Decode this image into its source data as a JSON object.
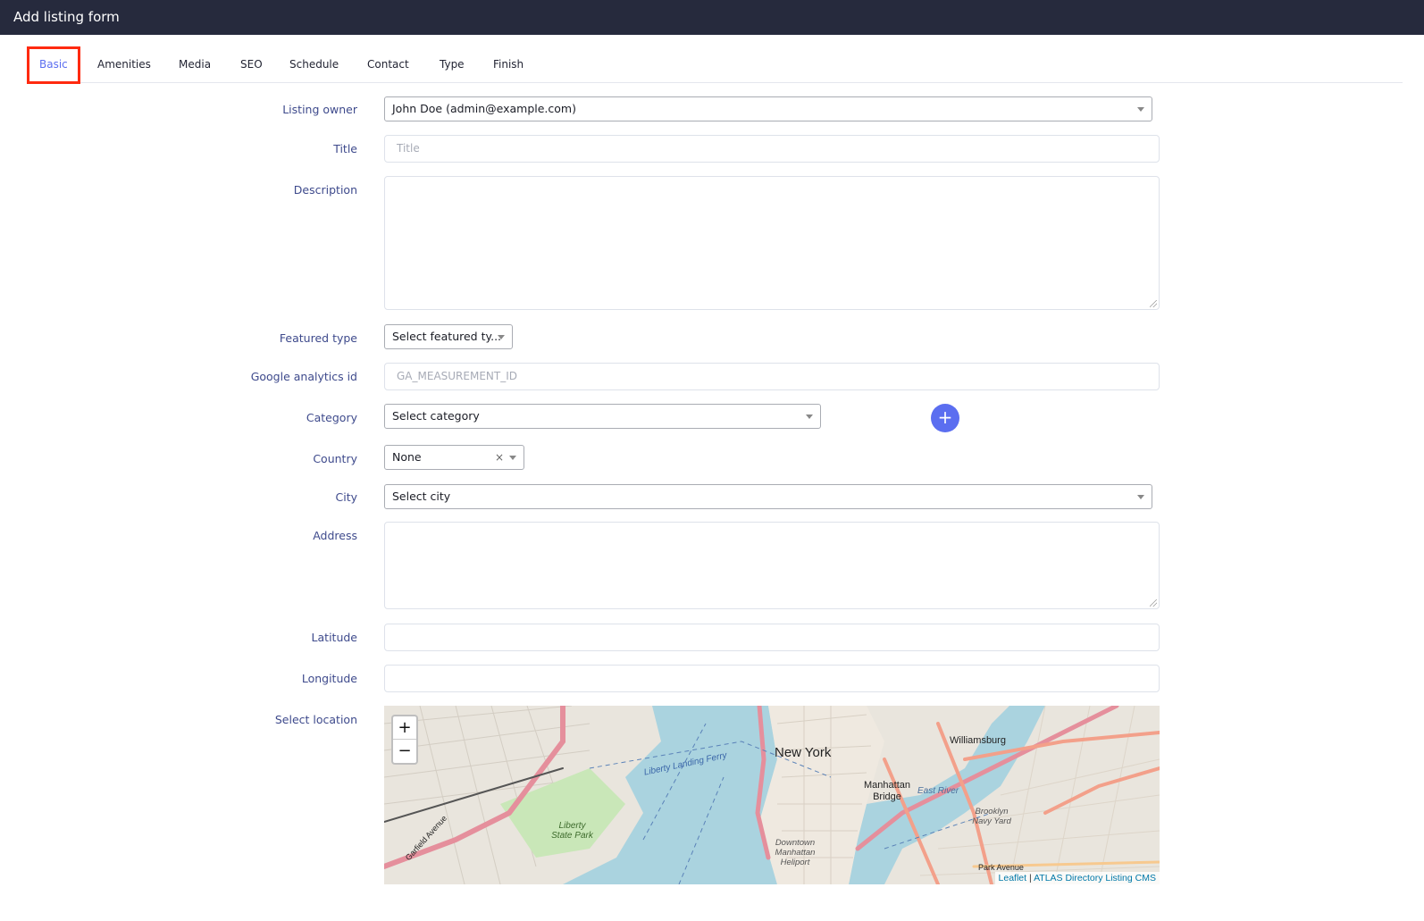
{
  "window": {
    "title": "Add listing form"
  },
  "tabs": [
    "Basic",
    "Amenities",
    "Media",
    "SEO",
    "Schedule",
    "Contact",
    "Type",
    "Finish"
  ],
  "active_tab": "Basic",
  "form": {
    "listing_owner": {
      "label": "Listing owner",
      "value": "John Doe (admin@example.com)"
    },
    "title": {
      "label": "Title",
      "placeholder": "Title"
    },
    "description": {
      "label": "Description"
    },
    "featured_type": {
      "label": "Featured type",
      "value": "Select featured ty..."
    },
    "google_analytics": {
      "label": "Google analytics id",
      "placeholder": "GA_MEASUREMENT_ID"
    },
    "category": {
      "label": "Category",
      "value": "Select category",
      "add_label": "+"
    },
    "country": {
      "label": "Country",
      "value": "None",
      "clear": "×"
    },
    "city": {
      "label": "City",
      "value": "Select city"
    },
    "address": {
      "label": "Address"
    },
    "latitude": {
      "label": "Latitude"
    },
    "longitude": {
      "label": "Longitude"
    },
    "select_location": {
      "label": "Select location"
    }
  },
  "map": {
    "zoom_in": "+",
    "zoom_out": "−",
    "attribution_leaflet": "Leaflet",
    "attribution_separator": "|",
    "attribution_cms": "ATLAS Directory Listing CMS",
    "labels": {
      "new_york": "New York",
      "williamsburg": "Williamsburg",
      "manhattan_bridge": "Manhattan Bridge",
      "liberty_state_park": "Liberty State Park",
      "brooklyn_navy_yard": "Brooklyn Navy Yard",
      "downtown_heliport": "Downtown Manhattan Heliport",
      "east_river": "East River",
      "liberty_landing_ferry": "Liberty Landing Ferry",
      "garfield_avenue": "Garfield Avenue",
      "park_avenue": "Park Avenue"
    }
  },
  "colors": {
    "accent": "#5b6ef0",
    "header_bg": "#262a3d",
    "label": "#3e4a8c",
    "highlight": "#ff2a10"
  }
}
